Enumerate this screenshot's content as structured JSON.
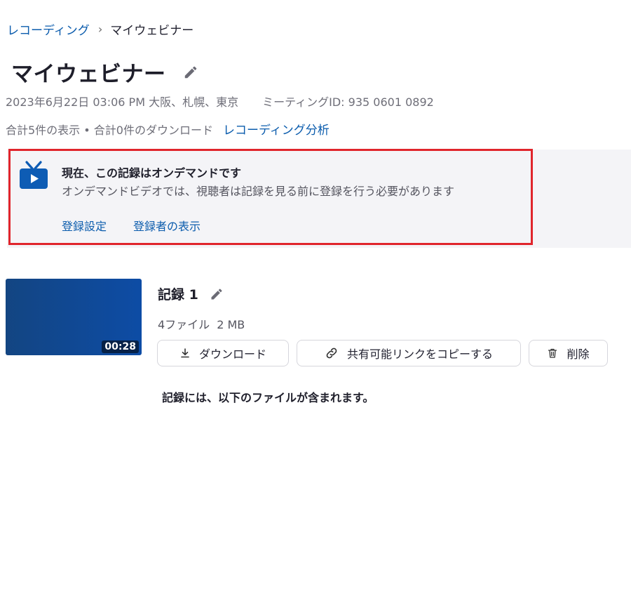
{
  "breadcrumb": {
    "parent": "レコーディング",
    "separator": "›",
    "current": "マイウェビナー"
  },
  "page": {
    "title": "マイウェビナー",
    "datetime": "2023年6月22日 03:06 PM 大阪、札幌、東京",
    "meeting_id": "ミーティングID: 935 0601 0892",
    "stats": "合計5件の表示 • 合計0件のダウンロード",
    "analytics_link": "レコーディング分析"
  },
  "banner": {
    "title": "現在、この記録はオンデマンドです",
    "subtitle": "オンデマンドビデオでは、視聴者は記録を見る前に登録を行う必要があります",
    "link_registration_settings": "登録設定",
    "link_view_registrants": "登録者の表示"
  },
  "recording": {
    "title": "記録 1",
    "files": "4ファイル",
    "size": "2 MB",
    "duration": "00:28",
    "download_label": "ダウンロード",
    "share_label": "共有可能リンクをコピーする",
    "delete_label": "削除",
    "files_heading": "記録には、以下のファイルが含まれます。"
  },
  "colors": {
    "link": "#0b5cad",
    "highlight_border": "#e0252c",
    "thumbnail": "#0d4ca5",
    "tv_icon": "#0e5cb4"
  },
  "icons": {
    "edit": "pencil-icon",
    "tv": "tv-icon",
    "play": "play-icon",
    "download": "download-icon",
    "link": "link-icon",
    "delete": "trash-icon"
  }
}
